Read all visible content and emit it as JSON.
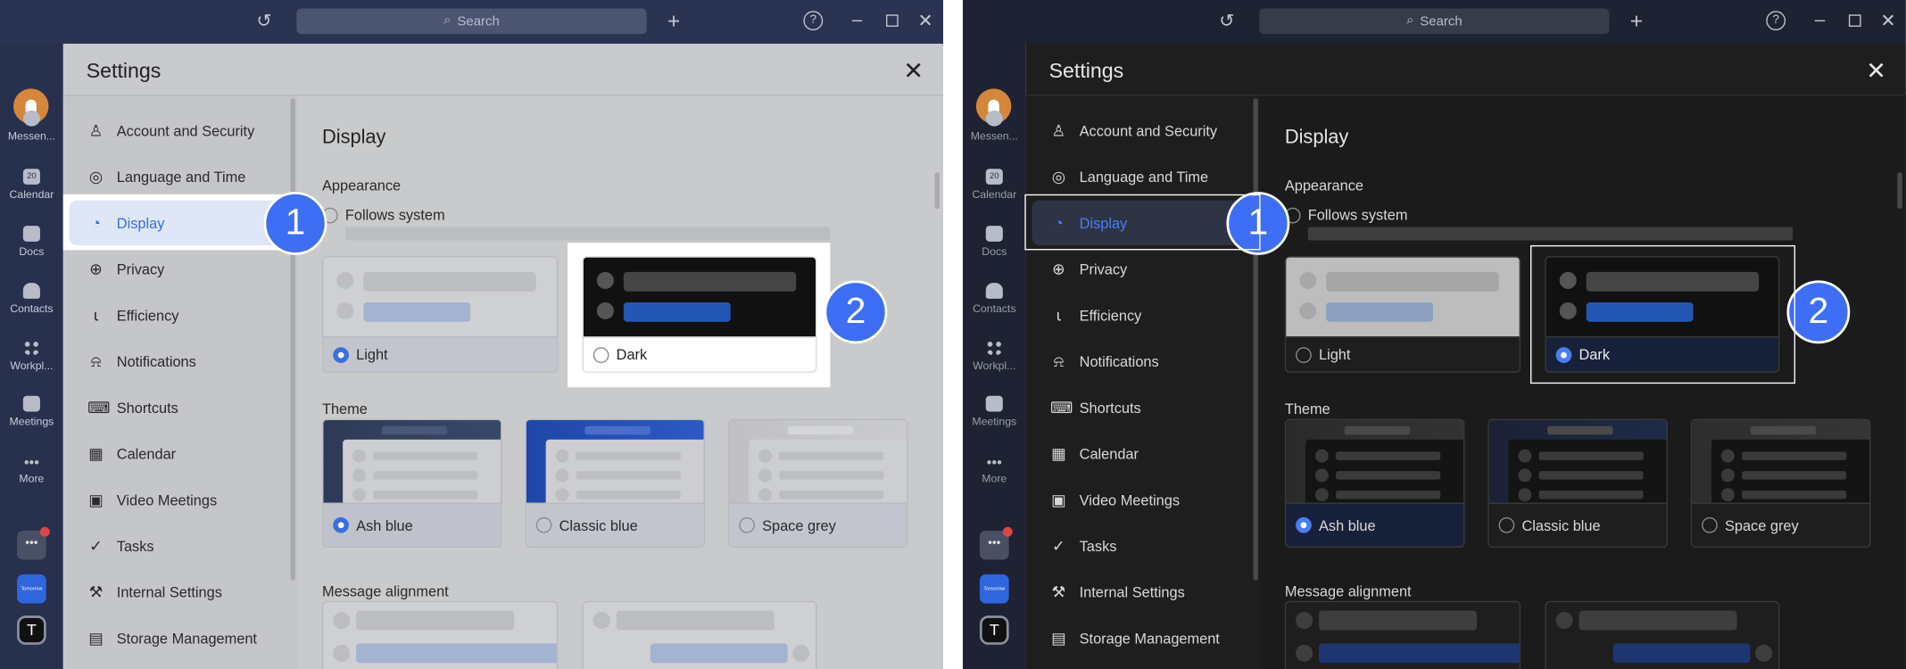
{
  "topbar": {
    "search_placeholder": "Search",
    "icons": [
      "history-icon",
      "search-icon",
      "plus-icon",
      "help-icon",
      "minimize-icon",
      "maximize-icon",
      "close-icon"
    ]
  },
  "rail": {
    "items": [
      {
        "label": "Messen..."
      },
      {
        "label": "Calendar",
        "badge": "20"
      },
      {
        "label": "Docs"
      },
      {
        "label": "Contacts"
      },
      {
        "label": "Workpl..."
      },
      {
        "label": "Meetings"
      },
      {
        "label": "More"
      }
    ],
    "tomorrow": "Tomorrow",
    "tenant": "T"
  },
  "settings": {
    "title": "Settings",
    "nav": [
      {
        "label": "Account and Security",
        "icon": "user-icon"
      },
      {
        "label": "Language and Time",
        "icon": "globe-icon"
      },
      {
        "label": "Display",
        "icon": "palette-icon"
      },
      {
        "label": "Privacy",
        "icon": "shield-icon"
      },
      {
        "label": "Efficiency",
        "icon": "bulb-icon"
      },
      {
        "label": "Notifications",
        "icon": "bell-icon"
      },
      {
        "label": "Shortcuts",
        "icon": "keyboard-icon"
      },
      {
        "label": "Calendar",
        "icon": "calendar-icon"
      },
      {
        "label": "Video Meetings",
        "icon": "video-icon"
      },
      {
        "label": "Tasks",
        "icon": "check-icon"
      },
      {
        "label": "Internal Settings",
        "icon": "wrench-icon"
      },
      {
        "label": "Storage Management",
        "icon": "storage-icon"
      }
    ],
    "active_nav": "Display",
    "display": {
      "title": "Display",
      "appearance_label": "Appearance",
      "follows_system": "Follows system",
      "appearance_options": [
        "Light",
        "Dark"
      ],
      "theme_label": "Theme",
      "theme_options": [
        "Ash blue",
        "Classic blue",
        "Space grey"
      ],
      "message_alignment_label": "Message alignment"
    }
  },
  "panels": {
    "left": {
      "selected_appearance": "Light",
      "selected_theme": "Ash blue"
    },
    "right": {
      "selected_appearance": "Dark",
      "selected_theme": "Ash blue"
    }
  },
  "callouts": [
    "1",
    "2"
  ],
  "colors": {
    "accent": "#3a6fe0",
    "badge": "#3d6ef3",
    "avatar": "#d4863a"
  }
}
